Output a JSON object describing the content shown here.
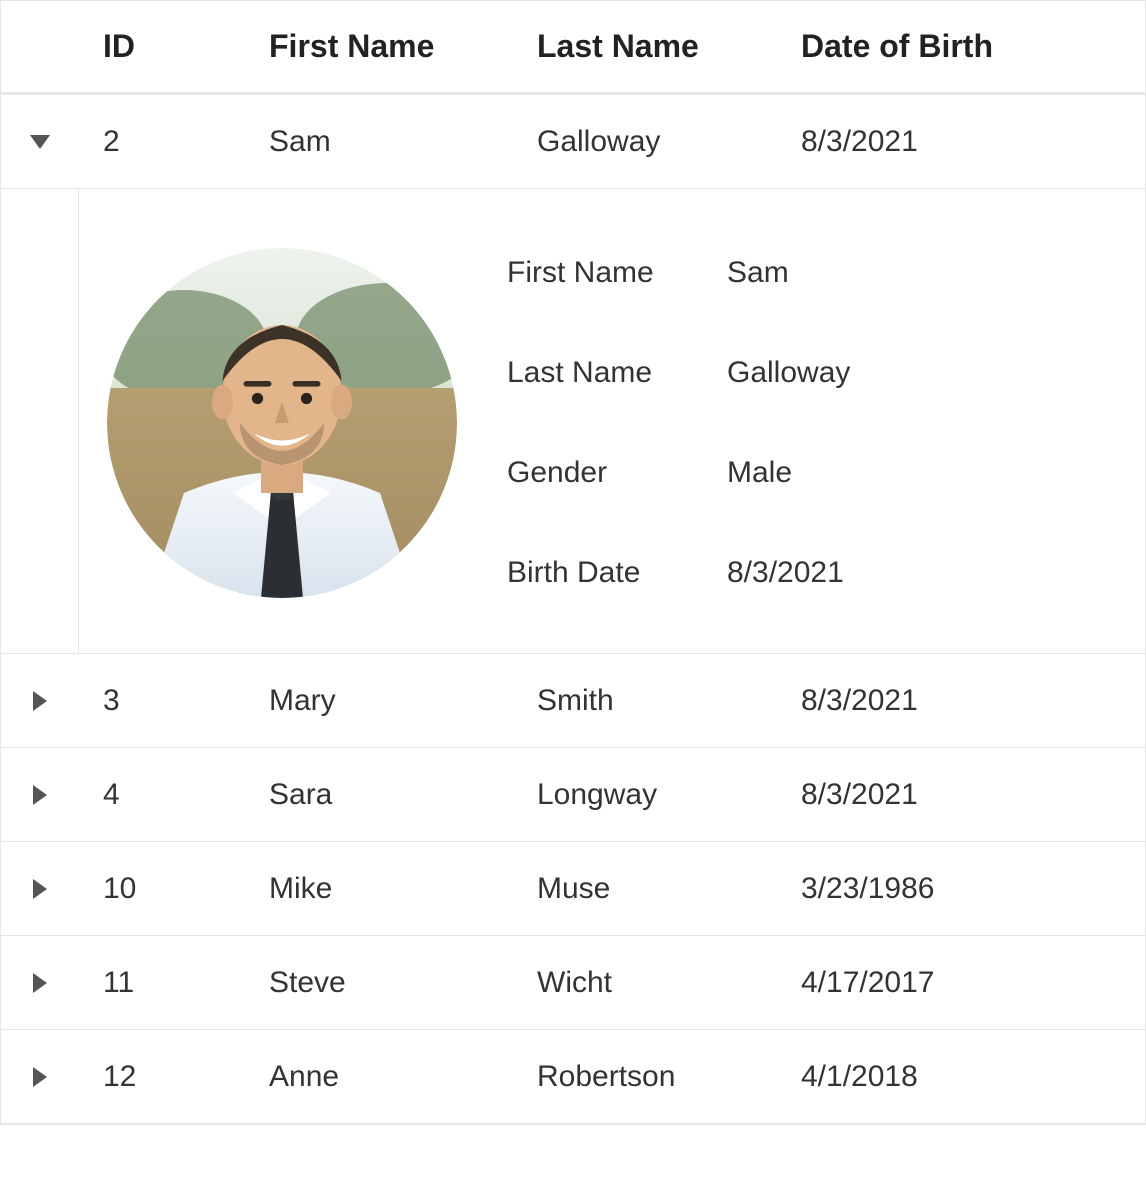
{
  "columns": {
    "id": "ID",
    "first": "First Name",
    "last": "Last Name",
    "dob": "Date of Birth"
  },
  "rows": [
    {
      "expanded": true,
      "id": "2",
      "first": "Sam",
      "last": "Galloway",
      "dob": "8/3/2021"
    },
    {
      "expanded": false,
      "id": "3",
      "first": "Mary",
      "last": "Smith",
      "dob": "8/3/2021"
    },
    {
      "expanded": false,
      "id": "4",
      "first": "Sara",
      "last": "Longway",
      "dob": "8/3/2021"
    },
    {
      "expanded": false,
      "id": "10",
      "first": "Mike",
      "last": "Muse",
      "dob": "3/23/1986"
    },
    {
      "expanded": false,
      "id": "11",
      "first": "Steve",
      "last": "Wicht",
      "dob": "4/17/2017"
    },
    {
      "expanded": false,
      "id": "12",
      "first": "Anne",
      "last": "Robertson",
      "dob": "4/1/2018"
    }
  ],
  "detail": {
    "labels": {
      "first": "First Name",
      "last": "Last Name",
      "gender": "Gender",
      "birth": "Birth Date"
    },
    "values": {
      "first": "Sam",
      "last": "Galloway",
      "gender": "Male",
      "birth": "8/3/2021"
    }
  }
}
